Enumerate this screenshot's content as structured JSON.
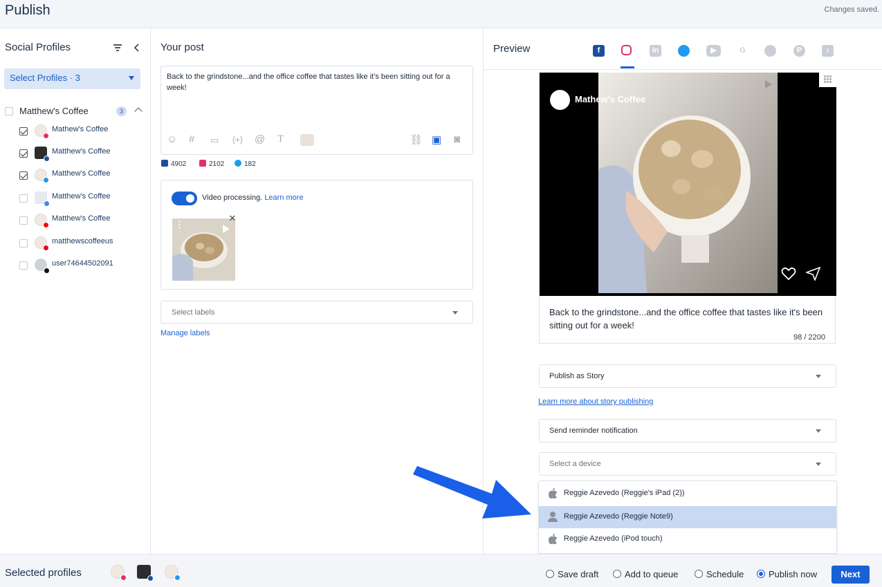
{
  "header": {
    "title": "Publish",
    "status": "Changes saved."
  },
  "profiles_panel": {
    "title": "Social Profiles",
    "select_label": "Select Profiles · 3",
    "group": {
      "name": "Matthew's Coffee",
      "count": "3"
    },
    "items": [
      {
        "name": "Mathew's Coffee",
        "checked": true,
        "network": "instagram"
      },
      {
        "name": "Matthew's Coffee",
        "checked": true,
        "network": "facebook"
      },
      {
        "name": "Matthew's Coffee",
        "checked": true,
        "network": "twitter"
      },
      {
        "name": "Matthew's Coffee",
        "checked": false,
        "network": "google"
      },
      {
        "name": "Matthew's Coffee",
        "checked": false,
        "network": "youtube"
      },
      {
        "name": "matthewscoffeeus",
        "checked": false,
        "network": "pinterest"
      },
      {
        "name": "user74644502091",
        "checked": false,
        "network": "tiktok"
      }
    ]
  },
  "post": {
    "title": "Your post",
    "text": "Back to the grindstone...and the office coffee that tastes like it's been sitting out for a week!",
    "counts": {
      "facebook": "4902",
      "instagram": "2102",
      "twitter": "182"
    },
    "video_processing": "Video processing.",
    "learn_more": "Learn more",
    "labels_placeholder": "Select labels",
    "manage_labels": "Manage labels"
  },
  "preview": {
    "title": "Preview",
    "active_tab": "instagram",
    "account_name": "Mathew's Coffee",
    "caption": "Back to the grindstone...and the office coffee that tastes like it's been sitting out for a week!",
    "char_count": "98 / 2200",
    "publish_as": "Publish as Story",
    "story_link": "Learn more about story publishing",
    "reminder": "Send reminder notification",
    "device_placeholder": "Select a device",
    "devices": [
      {
        "label": "Reggie Azevedo (Reggie's iPad (2))",
        "icon": "apple-icon",
        "selected": false
      },
      {
        "label": "Reggie Azevedo (Reggie Note9)",
        "icon": "person-icon",
        "selected": true
      },
      {
        "label": "Reggie Azevedo (iPod touch)",
        "icon": "apple-icon",
        "selected": false
      }
    ]
  },
  "footer": {
    "selected_label": "Selected profiles",
    "options": [
      {
        "label": "Save draft",
        "selected": false
      },
      {
        "label": "Add to queue",
        "selected": false
      },
      {
        "label": "Schedule",
        "selected": false
      },
      {
        "label": "Publish now",
        "selected": true
      }
    ],
    "next_label": "Next"
  },
  "colors": {
    "accent": "#1a61d6",
    "facebook": "#1c4e9e",
    "instagram": "#e1306c",
    "twitter": "#1d9bf0",
    "youtube": "#ff0000",
    "pinterest": "#e60023",
    "tiktok": "#111111",
    "google": "#4285f4"
  }
}
